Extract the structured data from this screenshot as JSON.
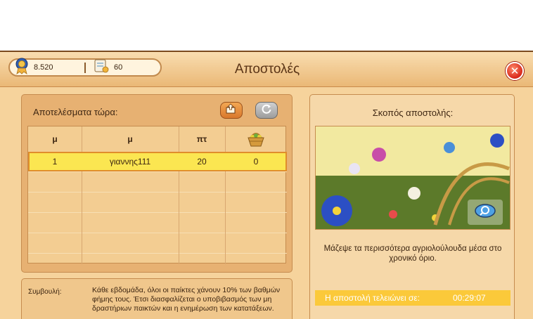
{
  "window": {
    "title": "Αποστολές"
  },
  "stats": {
    "gold": "8.520",
    "tasks": "60"
  },
  "results": {
    "title": "Αποτελέσματα τώρα:",
    "headers": [
      "μ",
      "μ",
      "πτ",
      ""
    ],
    "rows": [
      {
        "rank": "1",
        "name": "γιαννης111",
        "points": "20",
        "collected": "0"
      }
    ]
  },
  "tip": {
    "label": "Συμβουλή:",
    "text": "Κάθε εβδομάδα, όλοι οι παίκτες χάνουν 10% των βαθμών φήμης τους. Έτσι διασφαλίζεται ο υποβιβασμός των μη δραστήριων παικτών και η ενημέρωση των κατατάξεων."
  },
  "goal": {
    "title": "Σκοπός αποστολής:",
    "description": "Μάζεψε τα περισσότερα αγριολούλουδα μέσα στο χρονικό όριο."
  },
  "timer": {
    "label": "Η αποστολή τελειώνει σε:",
    "value": "00:29:07"
  },
  "colors": {
    "accent": "#e08d2b",
    "highlight": "#fbe651",
    "timer": "#fbc93a",
    "close": "#d8271b"
  },
  "icons": {
    "gold": "gold-medal-icon",
    "tasks": "scroll-quest-icon",
    "share": "share-icon",
    "refresh": "refresh-icon",
    "basket": "flower-basket-icon",
    "zoom": "magnifier-icon",
    "close": "close-icon"
  }
}
